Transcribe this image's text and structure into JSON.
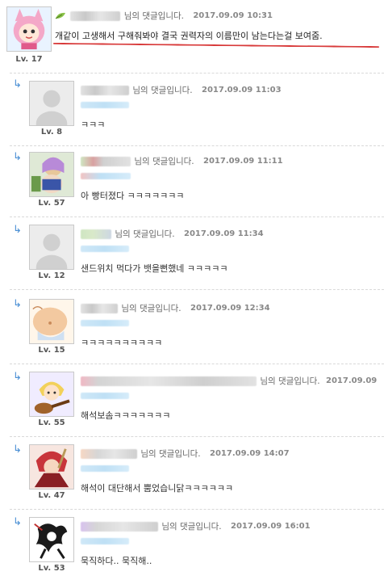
{
  "comments": [
    {
      "level": "Lv. 17",
      "suffix": "님의 댓글입니다.",
      "date": "2017.09.09 10:31",
      "body": "개같이 고생해서 구해줘봐야 결국 권력자의 이름만이 남는다는걸 보여줌.",
      "avatar_icon": "pink-cat-character-avatar"
    },
    {
      "level": "Lv. 8",
      "suffix": "님의 댓글입니다.",
      "date": "2017.09.09 11:03",
      "body": "ㅋㅋㅋ",
      "avatar_icon": "default-user-avatar"
    },
    {
      "level": "Lv. 57",
      "suffix": "님의 댓글입니다.",
      "date": "2017.09.09 11:11",
      "body": "아 빵터졌다 ㅋㅋㅋㅋㅋㅋㅋ",
      "avatar_icon": "anime-girl-avatar"
    },
    {
      "level": "Lv. 12",
      "suffix": "님의 댓글입니다.",
      "date": "2017.09.09 11:34",
      "body": "샌드위치 먹다가 뱃을뻔했네 ㅋㅋㅋㅋㅋ",
      "avatar_icon": "default-user-avatar"
    },
    {
      "level": "Lv. 15",
      "suffix": "님의 댓글입니다.",
      "date": "2017.09.09 12:34",
      "body": "ㅋㅋㅋㅋㅋㅋㅋㅋㅋㅋ",
      "avatar_icon": "cartoon-belly-avatar"
    },
    {
      "level": "Lv. 55",
      "suffix": "님의 댓글입니다.",
      "date": "2017.09.09",
      "body": "해석보솜ㅋㅋㅋㅋㅋㅋㅋ",
      "avatar_icon": "blonde-guitar-character-avatar"
    },
    {
      "level": "Lv. 47",
      "suffix": "님의 댓글입니다.",
      "date": "2017.09.09 14:07",
      "body": "해석이 대단해서 뿜었습니닭ㅋㅋㅋㅋㅋㅋ",
      "avatar_icon": "red-warrior-avatar"
    },
    {
      "level": "Lv. 53",
      "suffix": "님의 댓글입니다.",
      "date": "2017.09.09 16:01",
      "body": "묵직하다.. 묵직해..",
      "avatar_icon": "ink-sketch-avatar"
    }
  ],
  "icons": {
    "reply": "↳",
    "leaf": "leaf-icon"
  },
  "colors": {
    "accent_red": "#d83a3a",
    "reply_arrow": "#4a8fd4",
    "quote_bar": "#bfe0f5"
  }
}
